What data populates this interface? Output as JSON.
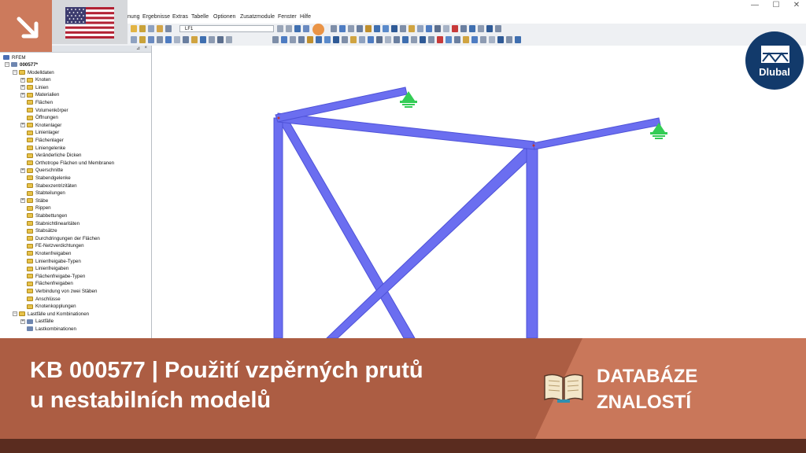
{
  "window": {
    "minimize_glyph": "—",
    "maximize_glyph": "☐",
    "close_glyph": "✕"
  },
  "menu": [
    "nung",
    "Ergebnisse",
    "Extras",
    "Tabelle",
    "Optionen",
    "Zusatzmodule",
    "Fenster",
    "Hilfe"
  ],
  "toolbar": {
    "load_case_value": "LF1"
  },
  "navigator": {
    "pin_glyph": "⊿",
    "close_glyph": "×",
    "root": "RFEM",
    "project": "000577*",
    "items": [
      "Modelldaten",
      "Knoten",
      "Linien",
      "Materialien",
      "Flächen",
      "Volumenkörper",
      "Öffnungen",
      "Knotenlager",
      "Linienlager",
      "Flächenlager",
      "Liniengelenke",
      "Veränderliche Dicken",
      "Orthotrope Flächen und Membranen",
      "Querschnitte",
      "Stabendgelenke",
      "Stabexzentrizitäten",
      "Stabteilungen",
      "Stäbe",
      "Rippen",
      "Stabbettungen",
      "Stabnichtlinearitäten",
      "Stabsätze",
      "Durchdringungen der Flächen",
      "FE-Netzverdichtungen",
      "Knotenfreigaben",
      "Linienfreigabe-Typen",
      "Linienfreigaben",
      "Flächenfreigabe-Typen",
      "Flächenfreigaben",
      "Verbindung von zwei Stäben",
      "Anschlüsse",
      "Knotenkopplungen",
      "Lastfälle und Kombinationen",
      "Lastfälle",
      "Lastkombinationen"
    ]
  },
  "brand": {
    "name": "Dlubal"
  },
  "banner": {
    "title_line1": "KB 000577 | Použití vzpěrných prutů",
    "title_line2": "u nestabilních modelů",
    "category_line1": "DATABÁZE",
    "category_line2": "ZNALOSTÍ"
  },
  "colors": {
    "member_blue": "#6b6ef0",
    "support_green": "#33cc55",
    "banner_dark": "#ac5d43",
    "banner_light": "#c9775a",
    "brand_navy": "#123a6b"
  }
}
